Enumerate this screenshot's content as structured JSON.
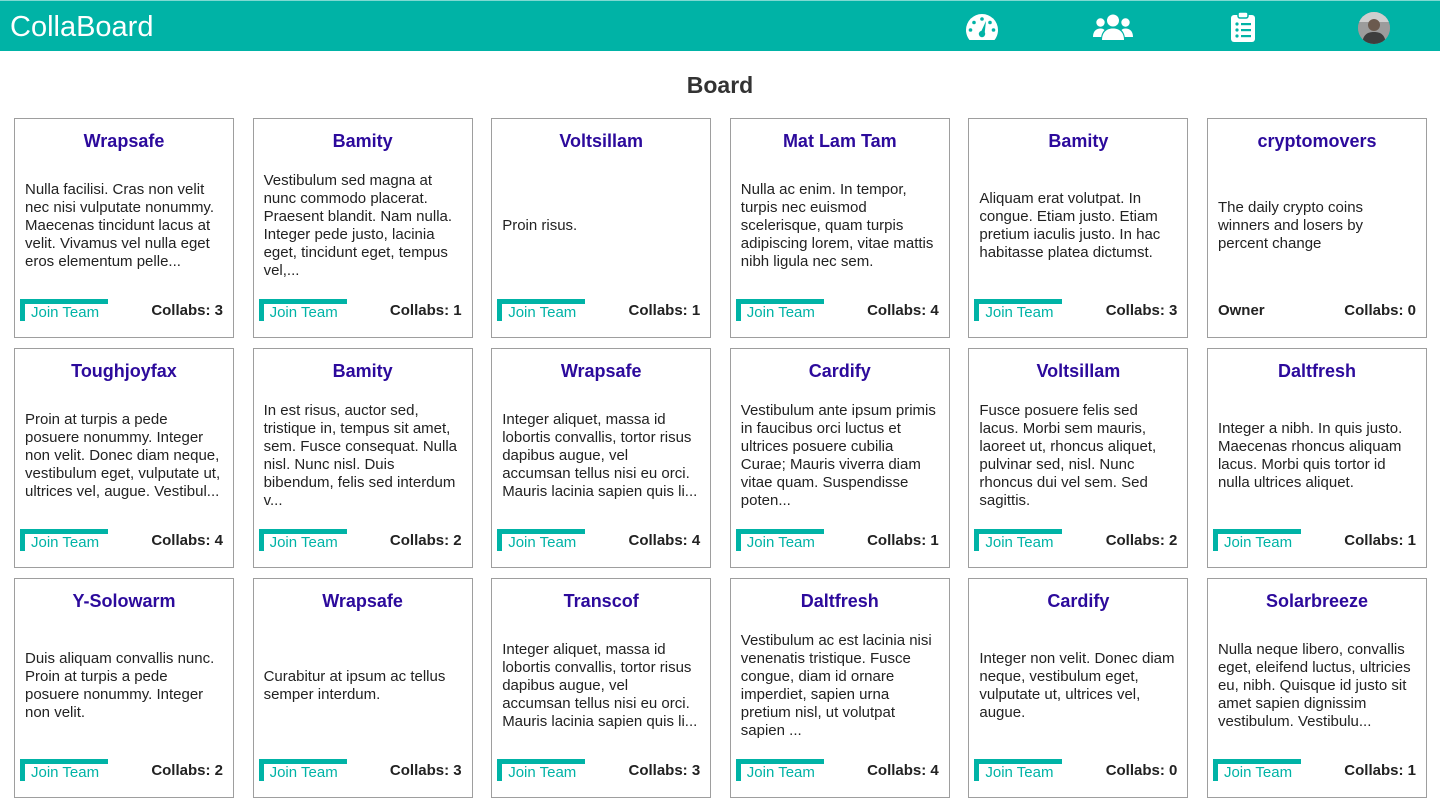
{
  "app": {
    "brand": "CollaBoard"
  },
  "nav": {
    "icons": [
      "dashboard-icon",
      "users-icon",
      "clipboard-list-icon"
    ],
    "accent_color": "#00b3a6"
  },
  "page": {
    "title": "Board"
  },
  "labels": {
    "join": "Join Team",
    "owner": "Owner",
    "collabs_prefix": "Collabs: "
  },
  "colors": {
    "title": "#2c0a9c",
    "accent": "#00b3a6",
    "text": "#222222"
  },
  "cards": [
    {
      "title": "Wrapsafe",
      "desc": "Nulla facilisi. Cras non velit nec nisi vulputate nonummy. Maecenas tincidunt lacus at velit. Vivamus vel nulla eget eros elementum pelle...",
      "collabs": "Collabs: 3",
      "owner": false
    },
    {
      "title": "Bamity",
      "desc": "Vestibulum sed magna at nunc commodo placerat. Praesent blandit. Nam nulla. Integer pede justo, lacinia eget, tincidunt eget, tempus vel,...",
      "collabs": "Collabs: 1",
      "owner": false
    },
    {
      "title": "Voltsillam",
      "desc": "Proin risus.",
      "collabs": "Collabs: 1",
      "owner": false
    },
    {
      "title": "Mat Lam Tam",
      "desc": "Nulla ac enim. In tempor, turpis nec euismod scelerisque, quam turpis adipiscing lorem, vitae mattis nibh ligula nec sem.",
      "collabs": "Collabs: 4",
      "owner": false
    },
    {
      "title": "Bamity",
      "desc": "Aliquam erat volutpat. In congue. Etiam justo. Etiam pretium iaculis justo. In hac habitasse platea dictumst.",
      "collabs": "Collabs: 3",
      "owner": false
    },
    {
      "title": "cryptomovers",
      "desc": "The daily crypto coins winners and losers by percent change",
      "collabs": "Collabs: 0",
      "owner": true
    },
    {
      "title": "Toughjoyfax",
      "desc": "Proin at turpis a pede posuere nonummy. Integer non velit. Donec diam neque, vestibulum eget, vulputate ut, ultrices vel, augue. Vestibul...",
      "collabs": "Collabs: 4",
      "owner": false
    },
    {
      "title": "Bamity",
      "desc": "In est risus, auctor sed, tristique in, tempus sit amet, sem. Fusce consequat. Nulla nisl. Nunc nisl. Duis bibendum, felis sed interdum v...",
      "collabs": "Collabs: 2",
      "owner": false
    },
    {
      "title": "Wrapsafe",
      "desc": "Integer aliquet, massa id lobortis convallis, tortor risus dapibus augue, vel accumsan tellus nisi eu orci. Mauris lacinia sapien quis li...",
      "collabs": "Collabs: 4",
      "owner": false
    },
    {
      "title": "Cardify",
      "desc": "Vestibulum ante ipsum primis in faucibus orci luctus et ultrices posuere cubilia Curae; Mauris viverra diam vitae quam. Suspendisse poten...",
      "collabs": "Collabs: 1",
      "owner": false
    },
    {
      "title": "Voltsillam",
      "desc": "Fusce posuere felis sed lacus. Morbi sem mauris, laoreet ut, rhoncus aliquet, pulvinar sed, nisl. Nunc rhoncus dui vel sem. Sed sagittis.",
      "collabs": "Collabs: 2",
      "owner": false
    },
    {
      "title": "Daltfresh",
      "desc": "Integer a nibh. In quis justo. Maecenas rhoncus aliquam lacus. Morbi quis tortor id nulla ultrices aliquet.",
      "collabs": "Collabs: 1",
      "owner": false
    },
    {
      "title": "Y-Solowarm",
      "desc": "Duis aliquam convallis nunc. Proin at turpis a pede posuere nonummy. Integer non velit.",
      "collabs": "Collabs: 2",
      "owner": false
    },
    {
      "title": "Wrapsafe",
      "desc": "Curabitur at ipsum ac tellus semper interdum.",
      "collabs": "Collabs: 3",
      "owner": false
    },
    {
      "title": "Transcof",
      "desc": "Integer aliquet, massa id lobortis convallis, tortor risus dapibus augue, vel accumsan tellus nisi eu orci. Mauris lacinia sapien quis li...",
      "collabs": "Collabs: 3",
      "owner": false
    },
    {
      "title": "Daltfresh",
      "desc": "Vestibulum ac est lacinia nisi venenatis tristique. Fusce congue, diam id ornare imperdiet, sapien urna pretium nisl, ut volutpat sapien ...",
      "collabs": "Collabs: 4",
      "owner": false
    },
    {
      "title": "Cardify",
      "desc": "Integer non velit. Donec diam neque, vestibulum eget, vulputate ut, ultrices vel, augue.",
      "collabs": "Collabs: 0",
      "owner": false
    },
    {
      "title": "Solarbreeze",
      "desc": "Nulla neque libero, convallis eget, eleifend luctus, ultricies eu, nibh. Quisque id justo sit amet sapien dignissim vestibulum. Vestibulu...",
      "collabs": "Collabs: 1",
      "owner": false
    }
  ]
}
